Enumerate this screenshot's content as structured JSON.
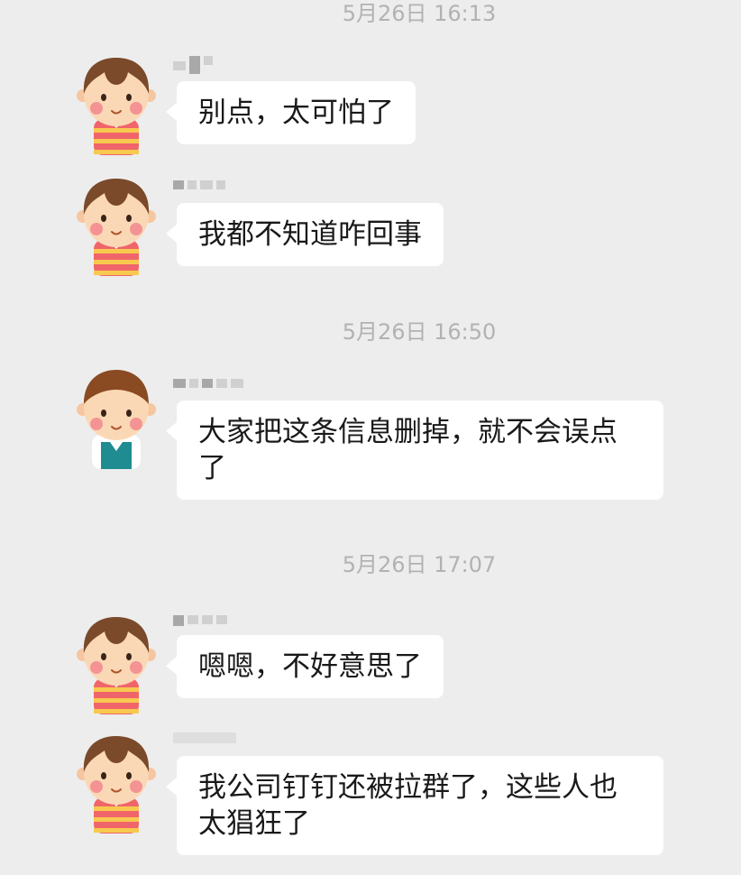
{
  "conversation": [
    {
      "type": "time",
      "text": "5月26日 16:13"
    },
    {
      "type": "message",
      "avatar": "boy-striped-shirt-avatar",
      "sender_name_blurred": true,
      "text": "别点，太可怕了"
    },
    {
      "type": "message",
      "avatar": "boy-striped-shirt-avatar",
      "sender_name_blurred": true,
      "text": "我都不知道咋回事"
    },
    {
      "type": "time",
      "text": "5月26日 16:50"
    },
    {
      "type": "message",
      "avatar": "boy-teal-vest-avatar",
      "sender_name_blurred": true,
      "text": "大家把这条信息删掉，就不会误点了"
    },
    {
      "type": "time",
      "text": "5月26日 17:07"
    },
    {
      "type": "message",
      "avatar": "boy-striped-shirt-avatar",
      "sender_name_blurred": true,
      "text": "嗯嗯，不好意思了"
    },
    {
      "type": "message",
      "avatar": "boy-striped-shirt-avatar",
      "sender_name_blurred": true,
      "text": "我公司钉钉还被拉群了，这些人也太猖狂了"
    }
  ],
  "colors": {
    "background": "#ededed",
    "bubble": "#ffffff",
    "timestamp": "#b2b2b2",
    "message_text": "#191919"
  }
}
